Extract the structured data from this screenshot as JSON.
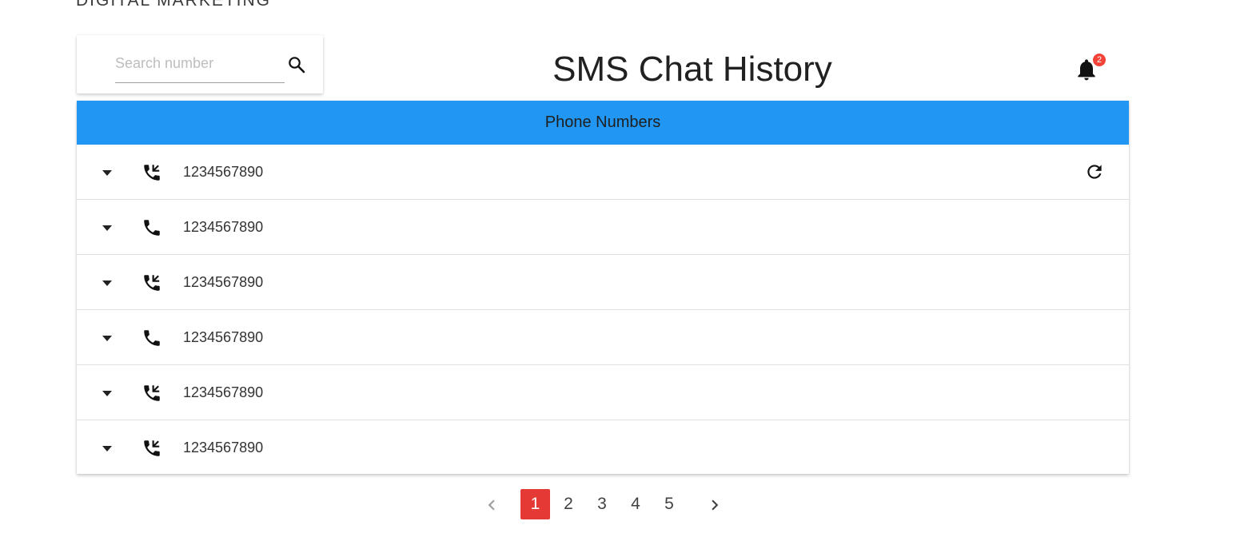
{
  "brand": {
    "text": "DIGITAL MARKETING"
  },
  "search": {
    "placeholder": "Search number",
    "value": ""
  },
  "title": "SMS Chat History",
  "notifications": {
    "count": "2"
  },
  "table": {
    "header": "Phone Numbers",
    "rows": [
      {
        "number": "1234567890",
        "icon": "phone-forwarded-icon",
        "refresh": true
      },
      {
        "number": "1234567890",
        "icon": "phone-icon",
        "refresh": false
      },
      {
        "number": "1234567890",
        "icon": "phone-forwarded-icon",
        "refresh": false
      },
      {
        "number": "1234567890",
        "icon": "phone-icon",
        "refresh": false
      },
      {
        "number": "1234567890",
        "icon": "phone-forwarded-icon",
        "refresh": false
      },
      {
        "number": "1234567890",
        "icon": "phone-forwarded-icon",
        "refresh": false
      }
    ]
  },
  "pagination": {
    "pages": [
      "1",
      "2",
      "3",
      "4",
      "5"
    ],
    "active": "1"
  },
  "colors": {
    "header_bg": "#2196f3",
    "active_page": "#e53935",
    "badge": "#f44336"
  }
}
